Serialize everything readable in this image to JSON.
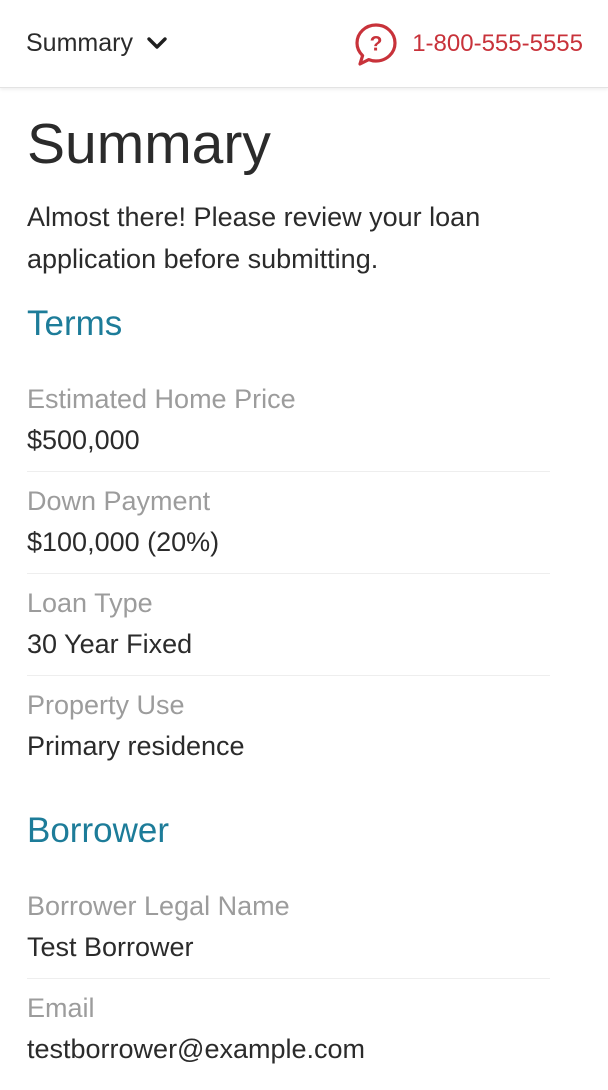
{
  "header": {
    "nav_label": "Summary",
    "phone": "1-800-555-5555",
    "accent_color": "#c8323a"
  },
  "page": {
    "title": "Summary",
    "intro": "Almost there! Please review your loan application before submitting."
  },
  "terms": {
    "title": "Terms",
    "fields": [
      {
        "label": "Estimated Home Price",
        "value": "$500,000"
      },
      {
        "label": "Down Payment",
        "value": "$100,000 (20%)"
      },
      {
        "label": "Loan Type",
        "value": "30 Year Fixed"
      },
      {
        "label": "Property Use",
        "value": "Primary residence"
      }
    ]
  },
  "borrower": {
    "title": "Borrower",
    "fields": [
      {
        "label": "Borrower Legal Name",
        "value": "Test Borrower"
      },
      {
        "label": "Email",
        "value": "testborrower@example.com"
      }
    ]
  },
  "colors": {
    "section_title": "#1d7c99",
    "label": "#9c9c9c",
    "text": "#2b2b2b"
  },
  "icons": {
    "nav": "chevron-down-icon",
    "help": "help-bubble-icon"
  }
}
